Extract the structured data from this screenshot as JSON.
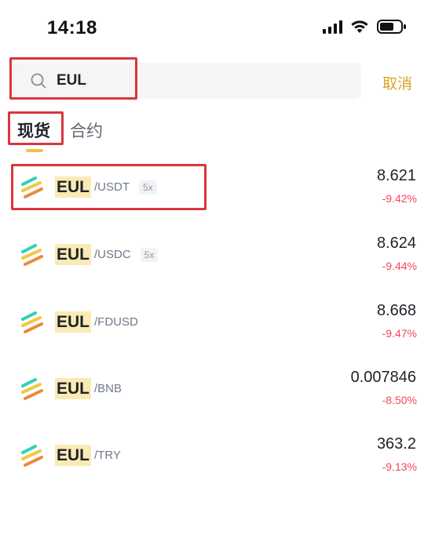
{
  "status_bar": {
    "time": "14:18"
  },
  "search": {
    "value": "EUL",
    "cancel_label": "取消"
  },
  "tabs": [
    {
      "label": "现货",
      "active": true
    },
    {
      "label": "合约",
      "active": false
    }
  ],
  "markets": [
    {
      "base": "EUL",
      "quote": "/USDT",
      "leverage": "5x",
      "price": "8.621",
      "change": "-9.42%"
    },
    {
      "base": "EUL",
      "quote": "/USDC",
      "leverage": "5x",
      "price": "8.624",
      "change": "-9.44%"
    },
    {
      "base": "EUL",
      "quote": "/FDUSD",
      "leverage": "",
      "price": "8.668",
      "change": "-9.47%"
    },
    {
      "base": "EUL",
      "quote": "/BNB",
      "leverage": "",
      "price": "0.007846",
      "change": "-8.50%"
    },
    {
      "base": "EUL",
      "quote": "/TRY",
      "leverage": "",
      "price": "363.2",
      "change": "-9.13%"
    }
  ],
  "colors": {
    "accent": "#d9a520",
    "negative": "#f6465d",
    "highlight": "#faeab4",
    "annotation": "#d9363e"
  },
  "icons": [
    "search-icon",
    "signal-icon",
    "wifi-icon",
    "battery-icon",
    "eul-coin-icon"
  ]
}
